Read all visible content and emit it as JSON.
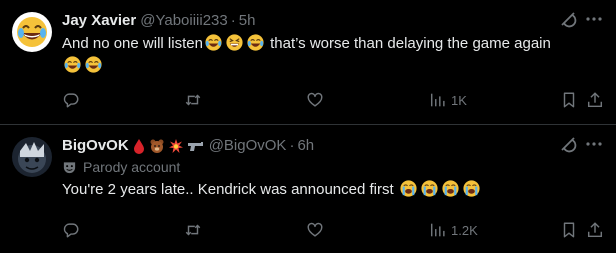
{
  "tweets": [
    {
      "display_name": "Jay Xavier",
      "handle": "@Yaboiiii233",
      "separator": "·",
      "time": "5h",
      "text_part1": "And no one will listen",
      "text_part2": " that’s worse than delaying the game again",
      "views": "1K",
      "avatar_icon": "laughing-emoji-avatar"
    },
    {
      "display_name": "BigOvOK",
      "handle": "@BigOvOK",
      "separator": "·",
      "time": "6h",
      "parody_label": "Parody account",
      "text": "You're 2 years late.. Kendrick was announced first",
      "views": "1.2K",
      "avatar_icon": "dark-character-avatar"
    }
  ],
  "colors": {
    "background": "#000000",
    "text_primary": "#e7e9ea",
    "text_secondary": "#71767b",
    "divider": "#2f3336"
  }
}
